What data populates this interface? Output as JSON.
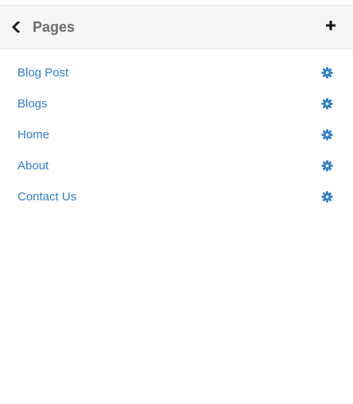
{
  "header": {
    "title": "Pages",
    "back_icon": "chevron-left-icon",
    "add_icon": "plus-icon"
  },
  "pages": [
    {
      "label": "Blog Post",
      "settings_icon": "gear-icon"
    },
    {
      "label": "Blogs",
      "settings_icon": "gear-icon"
    },
    {
      "label": "Home",
      "settings_icon": "gear-icon"
    },
    {
      "label": "About",
      "settings_icon": "gear-icon"
    },
    {
      "label": "Contact Us",
      "settings_icon": "gear-icon"
    }
  ],
  "colors": {
    "link": "#2f7fcc",
    "title": "#6b6b6b",
    "header_bg": "#f6f6f6"
  }
}
